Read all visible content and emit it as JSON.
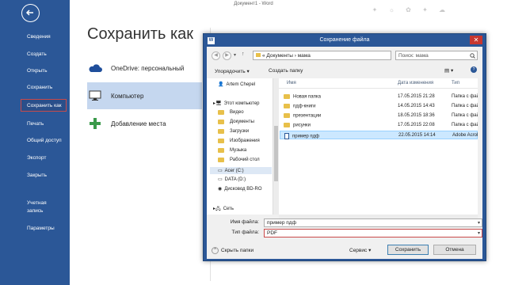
{
  "window_title": "Документ1 - Word",
  "sidebar": {
    "items": [
      {
        "label": "Сведения"
      },
      {
        "label": "Создать"
      },
      {
        "label": "Открыть"
      },
      {
        "label": "Сохранить"
      },
      {
        "label": "Сохранить как"
      },
      {
        "label": "Печать"
      },
      {
        "label": "Общий доступ"
      },
      {
        "label": "Экспорт"
      },
      {
        "label": "Закрыть"
      },
      {
        "label": "Учетная запись"
      },
      {
        "label": "Параметры"
      }
    ]
  },
  "main": {
    "heading": "Сохранить как",
    "places": [
      {
        "label": "OneDrive: персональный",
        "icon": "cloud-icon"
      },
      {
        "label": "Компьютер",
        "icon": "computer-icon"
      },
      {
        "label": "Добавление места",
        "icon": "plus-icon"
      }
    ]
  },
  "dialog": {
    "title": "Сохранение файла",
    "address": "« Документы › мама",
    "search_placeholder": "Поиск: мама",
    "toolbar": {
      "organize": "Упорядочить ▾",
      "new_folder": "Создать папку"
    },
    "tree": [
      {
        "label": "Artem Chepel"
      },
      {
        "label": "Этот компьютер"
      },
      {
        "label": "Видео"
      },
      {
        "label": "Документы"
      },
      {
        "label": "Загрузки"
      },
      {
        "label": "Изображения"
      },
      {
        "label": "Музыка"
      },
      {
        "label": "Рабочий стол"
      },
      {
        "label": "Acer (C:)"
      },
      {
        "label": "DATA (D:)"
      },
      {
        "label": "Дисковод BD-RO"
      },
      {
        "label": "Сеть"
      }
    ],
    "columns": {
      "name": "Имя",
      "date": "Дата изменения",
      "type": "Тип"
    },
    "files": [
      {
        "name": "Новая папка",
        "date": "17.05.2015 21:28",
        "type": "Папка с фай"
      },
      {
        "name": "пдф-книги",
        "date": "14.05.2015 14:43",
        "type": "Папка с фай"
      },
      {
        "name": "презентации",
        "date": "18.05.2015 18:36",
        "type": "Папка с фай"
      },
      {
        "name": "рисунки",
        "date": "17.05.2015 22:08",
        "type": "Папка с фай"
      },
      {
        "name": "пример пдф",
        "date": "22.05.2015 14:14",
        "type": "Adobe Acrob"
      }
    ],
    "filename_label": "Имя файла:",
    "filename_value": "пример пдф",
    "filetype_label": "Тип файла:",
    "filetype_value": "PDF",
    "hide_folders": "Скрыть папки",
    "service": "Сервис",
    "save": "Сохранить",
    "cancel": "Отмена",
    "close": "✕"
  }
}
